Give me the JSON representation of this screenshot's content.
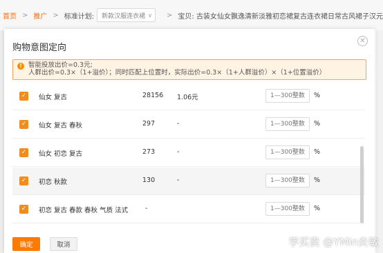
{
  "breadcrumb": {
    "home": "首页",
    "promotion": "推广",
    "plan_label": "标准计划:",
    "plan_value": "新款汉服连衣裙",
    "item_label": "宝贝: 古装女仙女飘逸清新淡雅初恋裙复古连衣裙日常古风裙子汉元素"
  },
  "modal": {
    "title": "购物意图定向",
    "close_icon": "close-icon",
    "notice_line1": "智能投放出价=0.3元;",
    "notice_line2": "人群出价=0.3×（1+溢价）；同时匹配上位置时，实际出价=0.3×（1+人群溢价）×（1+位置溢价）"
  },
  "rows": [
    {
      "keyword": "仙女 复古",
      "pv": "28156",
      "price": "1.06元",
      "placeholder": "1—300整数",
      "unit": "%",
      "checked": true
    },
    {
      "keyword": "仙女 复古 春秋",
      "pv": "297",
      "price": "-",
      "placeholder": "1—300整数",
      "unit": "%",
      "checked": true
    },
    {
      "keyword": "仙女 初恋 复古",
      "pv": "273",
      "price": "-",
      "placeholder": "1—300整数",
      "unit": "%",
      "checked": true
    },
    {
      "keyword": "初恋 秋款",
      "pv": "130",
      "price": "-",
      "placeholder": "1—300整数",
      "unit": "%",
      "checked": true
    },
    {
      "keyword": "初恋 复古 春款 春秋 气质 法式",
      "pv": "-",
      "price": "",
      "placeholder": "1—300整数",
      "unit": "%",
      "checked": true
    }
  ],
  "footer": {
    "confirm": "确定",
    "cancel": "取消"
  },
  "watermark": "学买卖 @YMin炎敏",
  "colors": {
    "accent": "#ff7a00",
    "checkbox": "#f28c1e",
    "notice_bg": "#fff3e4",
    "notice_border": "#f5a35b"
  }
}
